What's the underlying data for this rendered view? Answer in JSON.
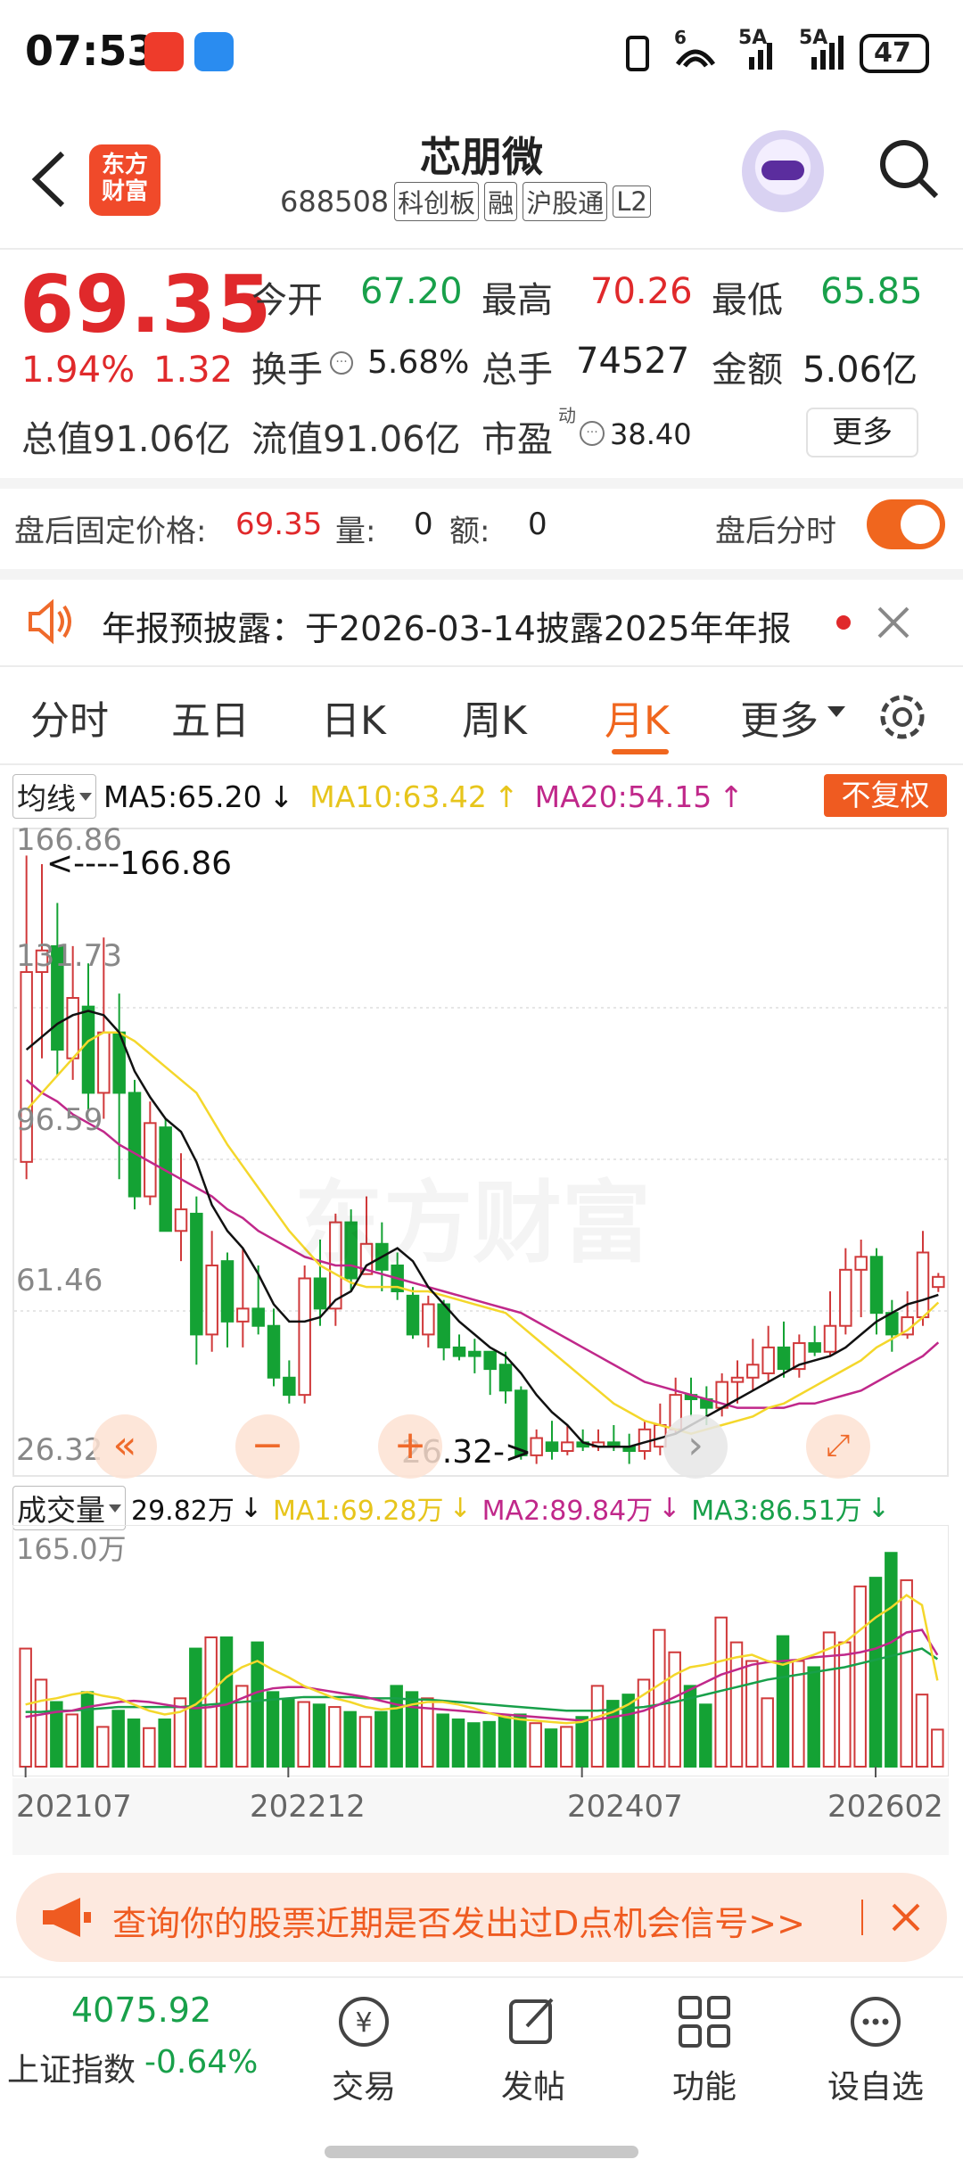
{
  "status": {
    "time": "07:53",
    "battery": "47",
    "signal_1": "5A",
    "signal_2": "5A",
    "wifi": "6"
  },
  "header": {
    "title": "芯朋微",
    "code": "688508",
    "badges": [
      "科创板",
      "融",
      "沪股通",
      "L2"
    ],
    "logo_line1": "东方",
    "logo_line2": "财富"
  },
  "quote": {
    "price": "69.35",
    "change_pct": "1.94%",
    "change": "1.32",
    "open_label": "今开",
    "open": "67.20",
    "high_label": "最高",
    "high": "70.26",
    "low_label": "最低",
    "low": "65.85",
    "turnover_label": "换手",
    "turnover": "5.68%",
    "volume_label": "总手",
    "volume": "74527",
    "amount_label": "金额",
    "amount": "5.06亿",
    "mktcap": "总值91.06亿",
    "float_cap": "流值91.06亿",
    "pe_label": "市盈",
    "pe_super": "动",
    "pe": "38.40",
    "more": "更多"
  },
  "after_hours": {
    "label": "盘后固定价格:",
    "price": "69.35",
    "vol_label": "量:",
    "vol": "0",
    "amt_label": "额:",
    "amt": "0",
    "timeshare_label": "盘后分时",
    "toggle_on": true
  },
  "notice": {
    "text": "年报预披露：于2026-03-14披露2025年年报"
  },
  "tabs": [
    "分时",
    "五日",
    "日K",
    "周K",
    "月K",
    "更多"
  ],
  "active_tab": "月K",
  "kline": {
    "ma_selector": "均线",
    "ma5": "MA5:65.20",
    "ma10": "MA10:63.42",
    "ma20": "MA20:54.15",
    "ma5_arrow": "↓",
    "ma10_arrow": "↑",
    "ma20_arrow": "↑",
    "adjust": "不复权",
    "y_labels": [
      "166.86",
      "131.73",
      "96.59",
      "61.46",
      "26.32"
    ],
    "high_note": "<----166.86",
    "low_note": "26.32->",
    "watermark": "东方财富",
    "colors": {
      "up": "#d0393a",
      "down": "#14a234",
      "ma5": "#111111",
      "ma10": "#f4d72b",
      "ma20": "#c0288a"
    }
  },
  "volume": {
    "selector": "成交量",
    "current": "29.82万",
    "current_arrow": "↓",
    "ma1": "MA1:69.28万",
    "ma2": "MA2:89.84万",
    "ma3": "MA3:86.51万",
    "ma1_arrow": "↓",
    "ma2_arrow": "↓",
    "ma3_arrow": "↓",
    "y_max": "165.0万",
    "x_labels": [
      "202107",
      "202212",
      "202407",
      "202602"
    ],
    "colors": {
      "ma1": "#f4d72b",
      "ma2": "#c0288a",
      "ma3": "#18a04a"
    }
  },
  "ad": {
    "text": "查询你的股票近期是否发出过D点机会信号>>"
  },
  "bottom_nav": {
    "index_value": "4075.92",
    "index_name": "上证指数",
    "index_change": "-0.64%",
    "items": [
      "交易",
      "发帖",
      "功能",
      "设自选"
    ]
  },
  "chart_data": {
    "type": "candlestick",
    "period": "monthly",
    "candles": [
      {
        "o": 96,
        "c": 140,
        "h": 167,
        "l": 92
      },
      {
        "o": 140,
        "c": 145,
        "h": 165,
        "l": 120
      },
      {
        "o": 146,
        "c": 122,
        "h": 156,
        "l": 116
      },
      {
        "o": 120,
        "c": 134,
        "h": 146,
        "l": 115
      },
      {
        "o": 132,
        "c": 112,
        "h": 142,
        "l": 108
      },
      {
        "o": 112,
        "c": 126,
        "h": 148,
        "l": 106
      },
      {
        "o": 126,
        "c": 112,
        "h": 135,
        "l": 92
      },
      {
        "o": 112,
        "c": 88,
        "h": 115,
        "l": 85
      },
      {
        "o": 88,
        "c": 105,
        "h": 110,
        "l": 86
      },
      {
        "o": 104,
        "c": 80,
        "h": 106,
        "l": 80
      },
      {
        "o": 80,
        "c": 85,
        "h": 98,
        "l": 73
      },
      {
        "o": 84,
        "c": 56,
        "h": 88,
        "l": 49
      },
      {
        "o": 56,
        "c": 72,
        "h": 80,
        "l": 52
      },
      {
        "o": 73,
        "c": 59,
        "h": 75,
        "l": 53
      },
      {
        "o": 59,
        "c": 62,
        "h": 76,
        "l": 53
      },
      {
        "o": 62,
        "c": 58,
        "h": 72,
        "l": 56
      },
      {
        "o": 58,
        "c": 46,
        "h": 62,
        "l": 44
      },
      {
        "o": 46,
        "c": 42,
        "h": 50,
        "l": 40
      },
      {
        "o": 42,
        "c": 69,
        "h": 72,
        "l": 40
      },
      {
        "o": 69,
        "c": 62,
        "h": 78,
        "l": 58
      },
      {
        "o": 62,
        "c": 82,
        "h": 84,
        "l": 58
      },
      {
        "o": 82,
        "c": 69,
        "h": 85,
        "l": 66
      },
      {
        "o": 70,
        "c": 77,
        "h": 88,
        "l": 70
      },
      {
        "o": 77,
        "c": 71,
        "h": 82,
        "l": 66
      },
      {
        "o": 72,
        "c": 66,
        "h": 75,
        "l": 64
      },
      {
        "o": 65,
        "c": 56,
        "h": 67,
        "l": 55
      },
      {
        "o": 56,
        "c": 63,
        "h": 65,
        "l": 53
      },
      {
        "o": 63,
        "c": 53,
        "h": 64,
        "l": 50
      },
      {
        "o": 53,
        "c": 51,
        "h": 56,
        "l": 50
      },
      {
        "o": 52,
        "c": 51,
        "h": 55,
        "l": 47
      },
      {
        "o": 52,
        "c": 48,
        "h": 52,
        "l": 42
      },
      {
        "o": 49,
        "c": 43,
        "h": 52,
        "l": 40
      },
      {
        "o": 43,
        "c": 28,
        "h": 44,
        "l": 27
      },
      {
        "o": 28,
        "c": 32,
        "h": 34,
        "l": 26
      },
      {
        "o": 31,
        "c": 29,
        "h": 36,
        "l": 27
      },
      {
        "o": 29,
        "c": 31,
        "h": 35,
        "l": 28
      },
      {
        "o": 31,
        "c": 30,
        "h": 34,
        "l": 29
      },
      {
        "o": 30,
        "c": 31,
        "h": 34,
        "l": 29
      },
      {
        "o": 31,
        "c": 30,
        "h": 35,
        "l": 29
      },
      {
        "o": 30,
        "c": 29,
        "h": 33,
        "l": 26
      },
      {
        "o": 29,
        "c": 34,
        "h": 36,
        "l": 27
      },
      {
        "o": 30,
        "c": 35,
        "h": 40,
        "l": 28
      },
      {
        "o": 34,
        "c": 42,
        "h": 46,
        "l": 33
      },
      {
        "o": 42,
        "c": 41,
        "h": 46,
        "l": 37
      },
      {
        "o": 41,
        "c": 39,
        "h": 44,
        "l": 35
      },
      {
        "o": 39,
        "c": 45,
        "h": 47,
        "l": 37
      },
      {
        "o": 45,
        "c": 46,
        "h": 50,
        "l": 40
      },
      {
        "o": 46,
        "c": 49,
        "h": 55,
        "l": 43
      },
      {
        "o": 47,
        "c": 53,
        "h": 58,
        "l": 45
      },
      {
        "o": 53,
        "c": 48,
        "h": 59,
        "l": 46
      },
      {
        "o": 48,
        "c": 54,
        "h": 56,
        "l": 46
      },
      {
        "o": 54,
        "c": 52,
        "h": 58,
        "l": 51
      },
      {
        "o": 52,
        "c": 58,
        "h": 66,
        "l": 51
      },
      {
        "o": 58,
        "c": 71,
        "h": 76,
        "l": 56
      },
      {
        "o": 71,
        "c": 74,
        "h": 78,
        "l": 60
      },
      {
        "o": 74,
        "c": 61,
        "h": 76,
        "l": 56
      },
      {
        "o": 61,
        "c": 56,
        "h": 64,
        "l": 52
      },
      {
        "o": 56,
        "c": 60,
        "h": 66,
        "l": 55
      },
      {
        "o": 60,
        "c": 75,
        "h": 80,
        "l": 58
      },
      {
        "o": 67,
        "c": 69.35,
        "h": 70.26,
        "l": 65.85
      }
    ],
    "ma5": [
      122,
      125,
      128,
      130,
      131,
      130,
      126,
      117,
      111,
      106,
      103,
      96,
      86,
      80,
      76,
      70,
      63,
      59,
      59,
      60,
      64,
      66,
      72,
      74,
      76,
      73,
      67,
      63,
      59,
      56,
      53,
      51,
      47,
      42,
      38,
      35,
      31,
      30,
      30,
      30,
      31,
      32,
      33,
      35,
      37,
      39,
      41,
      43,
      45,
      47,
      49,
      50,
      51,
      53,
      56,
      59,
      61,
      63,
      64,
      65.2
    ],
    "ma10": [
      108,
      112,
      116,
      120,
      124,
      126,
      126,
      124,
      121,
      118,
      115,
      112,
      106,
      100,
      95,
      90,
      85,
      80,
      76,
      72,
      70,
      68,
      67,
      67,
      67,
      66,
      66,
      65,
      64,
      63,
      62,
      61,
      58,
      55,
      52,
      49,
      46,
      43,
      40,
      38,
      36,
      35,
      34,
      33,
      34,
      35,
      36,
      37,
      39,
      40,
      42,
      44,
      46,
      48,
      50,
      53,
      55,
      57,
      60,
      63.42
    ],
    "ma20": [
      115,
      112,
      110,
      107,
      105,
      103,
      100,
      98,
      96,
      94,
      92,
      90,
      88,
      85,
      83,
      80,
      78,
      76,
      74,
      73,
      72,
      72,
      71,
      70,
      69,
      68,
      67,
      66,
      65,
      64,
      63,
      62,
      61,
      59,
      57,
      55,
      53,
      51,
      49,
      47,
      45,
      44,
      43,
      42,
      41,
      40,
      39,
      39,
      39,
      39,
      40,
      40,
      41,
      42,
      43,
      45,
      47,
      49,
      51,
      54.15
    ],
    "volumes": [
      95,
      70,
      52,
      42,
      60,
      32,
      45,
      38,
      31,
      38,
      55,
      95,
      104,
      104,
      65,
      100,
      60,
      54,
      52,
      50,
      48,
      44,
      40,
      44,
      65,
      60,
      55,
      42,
      38,
      35,
      36,
      40,
      42,
      35,
      30,
      32,
      40,
      65,
      53,
      58,
      70,
      110,
      92,
      65,
      50,
      120,
      100,
      85,
      55,
      105,
      85,
      80,
      108,
      100,
      145,
      152,
      172,
      150,
      58,
      29.82
    ],
    "vol_ma1": [
      50,
      53,
      55,
      58,
      60,
      57,
      55,
      50,
      45,
      42,
      44,
      50,
      60,
      72,
      80,
      85,
      78,
      72,
      65,
      60,
      55,
      52,
      48,
      46,
      47,
      50,
      52,
      52,
      50,
      47,
      43,
      40,
      38,
      37,
      36,
      35,
      36,
      40,
      44,
      50,
      58,
      66,
      74,
      80,
      82,
      85,
      88,
      90,
      85,
      82,
      86,
      90,
      95,
      100,
      110,
      120,
      128,
      138,
      130,
      69.28
    ],
    "vol_ma2": [
      40,
      42,
      44,
      45,
      48,
      50,
      52,
      53,
      52,
      50,
      48,
      47,
      48,
      50,
      55,
      60,
      63,
      64,
      64,
      62,
      60,
      58,
      56,
      53,
      50,
      48,
      47,
      46,
      45,
      44,
      43,
      42,
      41,
      40,
      39,
      38,
      37,
      38,
      40,
      42,
      45,
      50,
      56,
      62,
      68,
      74,
      78,
      82,
      84,
      85,
      86,
      88,
      89,
      90,
      92,
      95,
      100,
      108,
      110,
      89.84
    ],
    "vol_ma3": [
      44,
      44,
      45,
      45,
      46,
      47,
      48,
      48,
      48,
      48,
      48,
      49,
      50,
      51,
      52,
      53,
      54,
      55,
      56,
      56,
      56,
      56,
      55,
      55,
      55,
      54,
      54,
      53,
      52,
      51,
      50,
      49,
      48,
      47,
      46,
      45,
      45,
      45,
      46,
      47,
      48,
      50,
      52,
      55,
      58,
      61,
      64,
      67,
      70,
      72,
      74,
      76,
      78,
      80,
      83,
      86,
      89,
      92,
      95,
      86.51
    ],
    "y_range": [
      26.32,
      166.86
    ],
    "vol_max": 165.0,
    "x_labels": [
      "202107",
      "202212",
      "202407",
      "202602"
    ]
  }
}
